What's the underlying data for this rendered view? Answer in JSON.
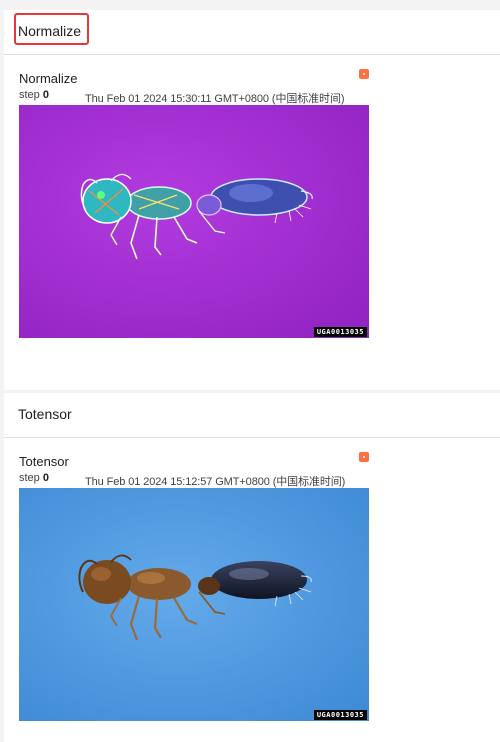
{
  "panels": [
    {
      "section_title": "Normalize",
      "card": {
        "title": "Normalize",
        "step_label": "step",
        "step_value": "0",
        "timestamp": "Thu Feb 01 2024 15:30:11 GMT+0800 (中国标准时间)",
        "watermark": "UGA0013035",
        "image_background": "#a62fd0"
      }
    },
    {
      "section_title": "Totensor",
      "card": {
        "title": "Totensor",
        "step_label": "step",
        "step_value": "0",
        "timestamp": "Thu Feb 01 2024 15:12:57 GMT+0800 (中国标准时间)",
        "watermark": "UGA0013035",
        "image_background": "#4e9be0"
      }
    }
  ],
  "colors": {
    "highlight": "#e53935",
    "menu_dot": "#ff7043"
  }
}
